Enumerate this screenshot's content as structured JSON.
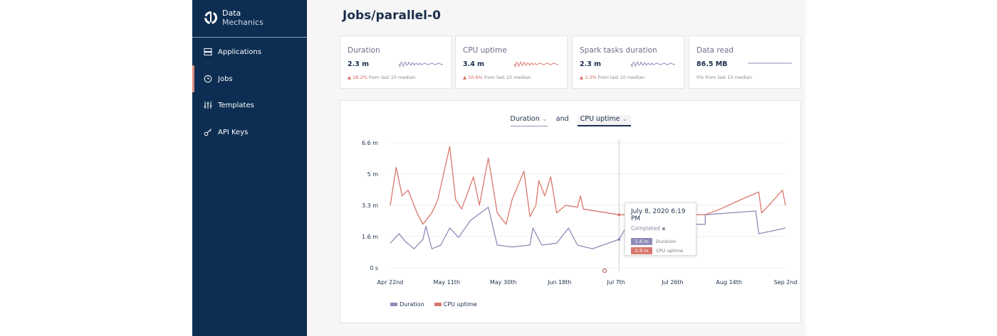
{
  "app": {
    "brand_line1": "Data",
    "brand_line2": "Mechanics"
  },
  "sidebar": {
    "items": [
      {
        "label": "Applications",
        "icon": "server-icon"
      },
      {
        "label": "Jobs",
        "icon": "clock-icon",
        "active": true
      },
      {
        "label": "Templates",
        "icon": "sliders-icon"
      },
      {
        "label": "API Keys",
        "icon": "key-icon"
      }
    ]
  },
  "page": {
    "title": "Jobs/parallel-0"
  },
  "cards": [
    {
      "label": "Duration",
      "value": "2.3 m",
      "change": "28.2%",
      "change_text": "from last 10 median",
      "trend": "up",
      "color": "#8d8cb8"
    },
    {
      "label": "CPU uptime",
      "value": "3.4 m",
      "change": "10.6%",
      "change_text": "from last 10 median",
      "trend": "up",
      "color": "#d9786d"
    },
    {
      "label": "Spark tasks duration",
      "value": "2.3 m",
      "change": "3.3%",
      "change_text": "from last 10 median",
      "trend": "up",
      "color": "#8d8cb8"
    },
    {
      "label": "Data read",
      "value": "86.5 MB",
      "change": "0%",
      "change_text": "from last 10 median",
      "trend": "flat",
      "color": "#8d8cb8"
    }
  ],
  "chart": {
    "metric_a": "Duration",
    "and_label": "and",
    "metric_b": "CPU uptime"
  },
  "tooltip": {
    "date": "July 8, 2020 6:19 PM",
    "status": "Completed",
    "rows": [
      {
        "value": "1.6 m",
        "label": "Duration"
      },
      {
        "value": "2.9 m",
        "label": "CPU uptime"
      }
    ]
  },
  "chart_data": {
    "type": "line",
    "x_ticks": [
      "Apr 22nd",
      "May 11th",
      "May 30th",
      "Jun 18th",
      "Jul 7th",
      "Jul 26th",
      "Aug 14th",
      "Sep 2nd"
    ],
    "x_range_days": [
      0,
      133
    ],
    "y_ticks": [
      "0 s",
      "1.6 m",
      "3.3 m",
      "5 m",
      "6.6 m"
    ],
    "y_range_min": [
      0,
      6.6
    ],
    "hover_day": 77,
    "series": [
      {
        "name": "Duration",
        "color": "#8d8cb8",
        "points": [
          [
            0,
            1.3
          ],
          [
            3,
            1.8
          ],
          [
            5,
            1.4
          ],
          [
            8,
            1.0
          ],
          [
            11,
            1.5
          ],
          [
            12,
            2.2
          ],
          [
            14,
            1.0
          ],
          [
            17,
            1.2
          ],
          [
            20,
            2.1
          ],
          [
            23,
            1.6
          ],
          [
            27,
            2.5
          ],
          [
            33,
            3.2
          ],
          [
            36,
            1.2
          ],
          [
            41,
            1.1
          ],
          [
            47,
            1.2
          ],
          [
            48,
            2.1
          ],
          [
            51,
            1.2
          ],
          [
            56,
            1.3
          ],
          [
            60,
            2.1
          ],
          [
            63,
            1.2
          ],
          [
            68,
            1.0
          ],
          [
            77,
            1.5
          ],
          [
            80,
            2.3
          ],
          [
            106,
            2.3
          ],
          [
            106,
            2.8
          ],
          [
            123,
            3.0
          ],
          [
            124,
            1.8
          ],
          [
            130,
            2.0
          ],
          [
            133,
            2.1
          ]
        ]
      },
      {
        "name": "CPU uptime",
        "color": "#d9786d",
        "points": [
          [
            0,
            3.3
          ],
          [
            2,
            5.3
          ],
          [
            4,
            3.8
          ],
          [
            6,
            4.1
          ],
          [
            9,
            2.9
          ],
          [
            11,
            2.3
          ],
          [
            14,
            2.9
          ],
          [
            16,
            3.6
          ],
          [
            20,
            6.4
          ],
          [
            22,
            3.6
          ],
          [
            24,
            3.1
          ],
          [
            28,
            4.8
          ],
          [
            30,
            3.3
          ],
          [
            33,
            5.8
          ],
          [
            36,
            2.9
          ],
          [
            39,
            2.3
          ],
          [
            41,
            3.6
          ],
          [
            45,
            5.1
          ],
          [
            47,
            2.7
          ],
          [
            49,
            3.3
          ],
          [
            50,
            4.6
          ],
          [
            52,
            3.8
          ],
          [
            54,
            4.8
          ],
          [
            56,
            2.9
          ],
          [
            59,
            3.3
          ],
          [
            63,
            3.2
          ],
          [
            64,
            3.8
          ],
          [
            65,
            3.1
          ],
          [
            77,
            2.8
          ],
          [
            106,
            2.8
          ],
          [
            111,
            3.1
          ],
          [
            118,
            3.6
          ],
          [
            124,
            4.0
          ],
          [
            125,
            2.9
          ],
          [
            128,
            3.4
          ],
          [
            132,
            4.1
          ],
          [
            133,
            3.3
          ]
        ]
      }
    ]
  }
}
